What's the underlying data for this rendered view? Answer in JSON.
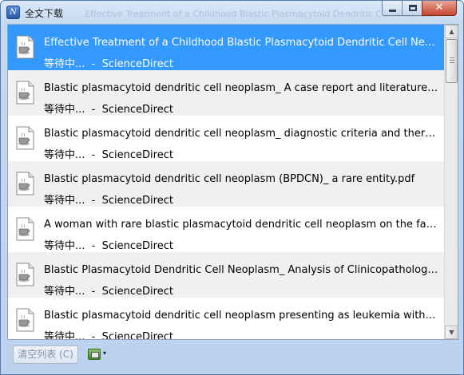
{
  "window": {
    "title": "全文下载",
    "title_ghost": "Effective Treatment of a Childhood Blastic Plasmacytoid Dendritic Cell Neoplasm",
    "app_icon": "N",
    "controls": {
      "minimize": "minimize-icon",
      "maximize": "maximize-icon",
      "close": "✕"
    }
  },
  "downloads": [
    {
      "name": "Effective Treatment of a Childhood Blastic Plasmacytoid Dendritic Cell Neoplasm with Hyper-CVAD.pdf",
      "status": "等待中...  -  ScienceDirect",
      "selected": true
    },
    {
      "name": "Blastic plasmacytoid dendritic cell neoplasm_ A case report and literature review.pdf",
      "status": "等待中...  -  ScienceDirect",
      "selected": false
    },
    {
      "name": "Blastic plasmacytoid dendritic cell neoplasm_ diagnostic criteria and therapeutic approaches.pdf",
      "status": "等待中...  -  ScienceDirect",
      "selected": false
    },
    {
      "name": "Blastic plasmacytoid dendritic cell neoplasm (BPDCN)_ a rare entity.pdf",
      "status": "等待中...  -  ScienceDirect",
      "selected": false
    },
    {
      "name": "A woman with rare blastic plasmacytoid dendritic cell neoplasm on the face.pdf",
      "status": "等待中...  -  ScienceDirect",
      "selected": false
    },
    {
      "name": "Blastic Plasmacytoid Dendritic Cell Neoplasm_ Analysis of Clinicopathological Features.pdf",
      "status": "等待中...  -  ScienceDirect",
      "selected": false
    },
    {
      "name": "Blastic plasmacytoid dendritic cell neoplasm presenting as leukemia without cutaneous lesions.pdf",
      "status": "等待中...  -  ScienceDirect",
      "selected": false
    }
  ],
  "footer": {
    "clear_label": "清空列表 (C)",
    "tool_icon": "green-toolbox-icon",
    "tool_arrow": "▾"
  },
  "scrollbar": {
    "up": "▲",
    "down": "▼"
  },
  "colors": {
    "selection": "#3399ff",
    "alt_row": "#f0f0f0",
    "frame": "#bcd2ee"
  }
}
